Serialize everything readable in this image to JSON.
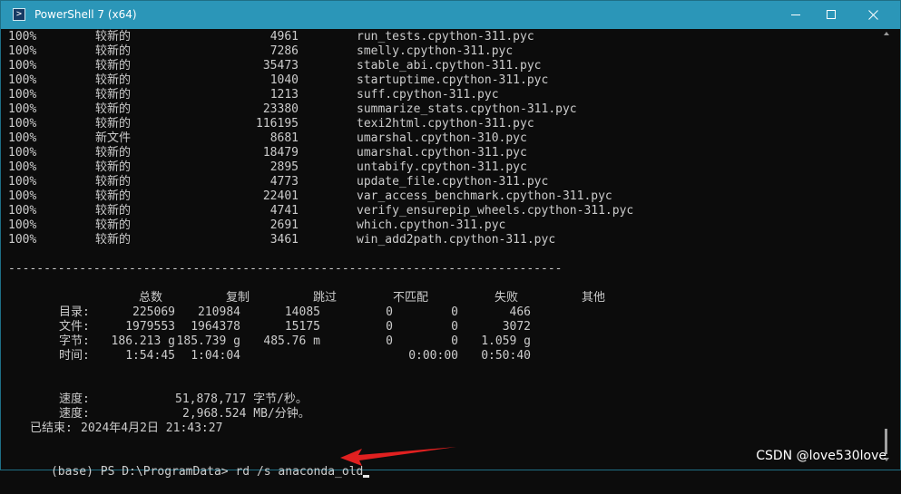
{
  "window": {
    "title": "PowerShell 7 (x64)",
    "icon": "powershell-icon",
    "accent_color": "#2b96b8",
    "controls": [
      "minimize-icon",
      "maximize-icon",
      "close-icon"
    ]
  },
  "copy_rows": [
    {
      "pct": "100%",
      "status": "较新的",
      "size": "4961",
      "file": "run_tests.cpython-311.pyc"
    },
    {
      "pct": "100%",
      "status": "较新的",
      "size": "7286",
      "file": "smelly.cpython-311.pyc"
    },
    {
      "pct": "100%",
      "status": "较新的",
      "size": "35473",
      "file": "stable_abi.cpython-311.pyc"
    },
    {
      "pct": "100%",
      "status": "较新的",
      "size": "1040",
      "file": "startuptime.cpython-311.pyc"
    },
    {
      "pct": "100%",
      "status": "较新的",
      "size": "1213",
      "file": "suff.cpython-311.pyc"
    },
    {
      "pct": "100%",
      "status": "较新的",
      "size": "23380",
      "file": "summarize_stats.cpython-311.pyc"
    },
    {
      "pct": "100%",
      "status": "较新的",
      "size": "116195",
      "file": "texi2html.cpython-311.pyc"
    },
    {
      "pct": "100%",
      "status": "新文件",
      "size": "8681",
      "file": "umarshal.cpython-310.pyc"
    },
    {
      "pct": "100%",
      "status": "较新的",
      "size": "18479",
      "file": "umarshal.cpython-311.pyc"
    },
    {
      "pct": "100%",
      "status": "较新的",
      "size": "2895",
      "file": "untabify.cpython-311.pyc"
    },
    {
      "pct": "100%",
      "status": "较新的",
      "size": "4773",
      "file": "update_file.cpython-311.pyc"
    },
    {
      "pct": "100%",
      "status": "较新的",
      "size": "22401",
      "file": "var_access_benchmark.cpython-311.pyc"
    },
    {
      "pct": "100%",
      "status": "较新的",
      "size": "4741",
      "file": "verify_ensurepip_wheels.cpython-311.pyc"
    },
    {
      "pct": "100%",
      "status": "较新的",
      "size": "2691",
      "file": "which.cpython-311.pyc"
    },
    {
      "pct": "100%",
      "status": "较新的",
      "size": "3461",
      "file": "win_add2path.cpython-311.pyc"
    }
  ],
  "separator": "------------------------------------------------------------------------------",
  "summary": {
    "headers": [
      "总数",
      "复制",
      "跳过",
      "不匹配",
      "失败",
      "其他"
    ],
    "rows": [
      {
        "label": "目录:",
        "total": "225069",
        "copied": "210984",
        "skipped": "14085",
        "mismatch": "0",
        "failed": "0",
        "extras": "466"
      },
      {
        "label": "文件:",
        "total": "1979553",
        "copied": "1964378",
        "skipped": "15175",
        "mismatch": "0",
        "failed": "0",
        "extras": "3072"
      },
      {
        "label": "字节:",
        "total": "186.213 g",
        "copied": "185.739 g",
        "skipped": "485.76 m",
        "mismatch": "0",
        "failed": "0",
        "extras": "1.059 g"
      },
      {
        "label": "时间:",
        "total": "1:54:45",
        "copied": "1:04:04",
        "skipped": "",
        "mismatch": "",
        "failed": "0:00:00",
        "extras": "0:50:40"
      }
    ]
  },
  "speed": [
    {
      "label": "速度:",
      "value": "51,878,717 字节/秒。"
    },
    {
      "label": "速度:",
      "value": "2,968.524 MB/分钟。"
    }
  ],
  "ended": {
    "label": "已结束:",
    "value": "2024年4月2日 21:43:27"
  },
  "prompt": {
    "text": "(base) PS D:\\ProgramData>",
    "command": "rd /s anaconda_old"
  },
  "annotation": {
    "color": "#e02020",
    "icon": "red-arrow-icon"
  },
  "watermark": "CSDN @love530love"
}
